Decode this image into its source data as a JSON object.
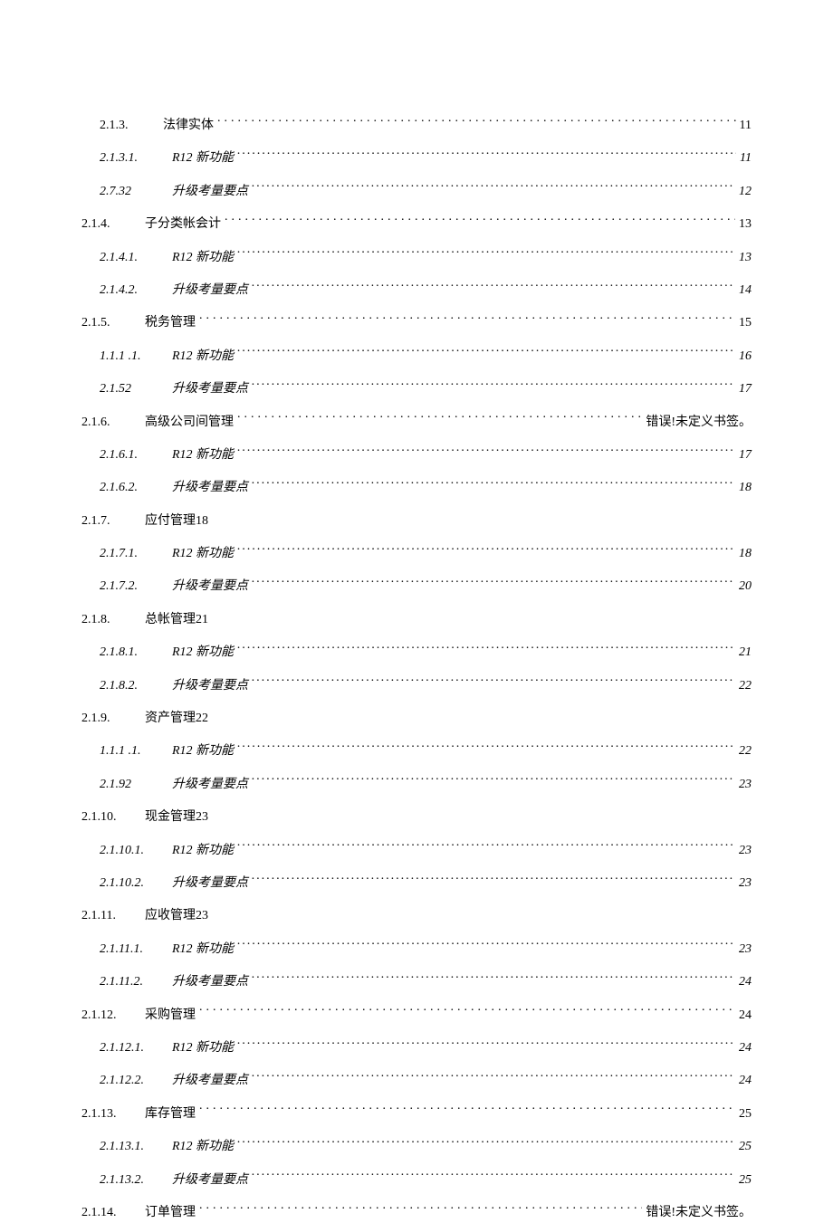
{
  "toc": [
    {
      "level": 0,
      "num": "2.1.3.",
      "title": "法律实体",
      "page": "11",
      "leader": true,
      "indent": 20
    },
    {
      "level": 1,
      "num": "2.1.3.1.",
      "title": "R12 新功能",
      "page": "11",
      "leader": true
    },
    {
      "level": 1,
      "num": "2.7.32",
      "title": "升级考量要点",
      "page": "12",
      "leader": true
    },
    {
      "level": 0,
      "num": "2.1.4.",
      "title": "子分类帐会计",
      "page": "13",
      "leader": true
    },
    {
      "level": 1,
      "num": "2.1.4.1.",
      "title": "R12 新功能",
      "page": "13",
      "leader": true
    },
    {
      "level": 1,
      "num": "2.1.4.2.",
      "title": "升级考量要点",
      "page": "14",
      "leader": true
    },
    {
      "level": 0,
      "num": "2.1.5.",
      "title": "税务管理",
      "page": "15",
      "leader": true
    },
    {
      "level": 1,
      "num": "1.1.1  .1.",
      "title": "R12 新功能",
      "page": "16",
      "leader": true
    },
    {
      "level": 1,
      "num": "2.1.52",
      "title": "升级考量要点",
      "page": "17",
      "leader": true
    },
    {
      "level": 0,
      "num": "2.1.6.",
      "title": "高级公司间管理",
      "page": "错误!未定义书签。",
      "leader": true
    },
    {
      "level": 1,
      "num": "2.1.6.1.",
      "title": "R12 新功能",
      "page": "17",
      "leader": true
    },
    {
      "level": 1,
      "num": "2.1.6.2.",
      "title": "升级考量要点",
      "page": "18",
      "leader": true
    },
    {
      "level": 0,
      "num": "2.1.7.",
      "title": "应付管理18",
      "page": "",
      "leader": false
    },
    {
      "level": 1,
      "num": "2.1.7.1.",
      "title": "R12 新功能",
      "page": "18",
      "leader": true
    },
    {
      "level": 1,
      "num": "2.1.7.2.",
      "title": "升级考量要点",
      "page": "20",
      "leader": true
    },
    {
      "level": 0,
      "num": "2.1.8.",
      "title": "总帐管理21",
      "page": "",
      "leader": false
    },
    {
      "level": 1,
      "num": "2.1.8.1.",
      "title": "R12 新功能",
      "page": "21",
      "leader": true
    },
    {
      "level": 1,
      "num": "2.1.8.2.",
      "title": "升级考量要点",
      "page": "22",
      "leader": true
    },
    {
      "level": 0,
      "num": "2.1.9.",
      "title": "资产管理22",
      "page": "",
      "leader": false
    },
    {
      "level": 1,
      "num": "1.1.1  .1.",
      "title": "R12 新功能",
      "page": "22",
      "leader": true
    },
    {
      "level": 1,
      "num": "2.1.92",
      "title": "升级考量要点",
      "page": "23",
      "leader": true
    },
    {
      "level": 0,
      "num": "2.1.10.",
      "title": "现金管理23",
      "page": "",
      "leader": false
    },
    {
      "level": 1,
      "num": "2.1.10.1.",
      "title": "R12 新功能",
      "page": "23",
      "leader": true
    },
    {
      "level": 1,
      "num": "2.1.10.2.",
      "title": "升级考量要点",
      "page": "23",
      "leader": true
    },
    {
      "level": 0,
      "num": "2.1.11.",
      "title": "应收管理23",
      "page": "",
      "leader": false
    },
    {
      "level": 1,
      "num": "2.1.11.1.",
      "title": "R12 新功能",
      "page": "23",
      "leader": true
    },
    {
      "level": 1,
      "num": "2.1.11.2.",
      "title": "升级考量要点",
      "page": "24",
      "leader": true
    },
    {
      "level": 0,
      "num": "2.1.12.",
      "title": "采购管理",
      "page": "24",
      "leader": true
    },
    {
      "level": 1,
      "num": "2.1.12.1.",
      "title": "R12 新功能",
      "page": "24",
      "leader": true
    },
    {
      "level": 1,
      "num": "2.1.12.2.",
      "title": "升级考量要点",
      "page": "24",
      "leader": true
    },
    {
      "level": 0,
      "num": "2.1.13.",
      "title": "库存管理",
      "page": "25",
      "leader": true
    },
    {
      "level": 1,
      "num": "2.1.13.1.",
      "title": "R12 新功能",
      "page": "25",
      "leader": true
    },
    {
      "level": 1,
      "num": "2.1.13.2.",
      "title": "升级考量要点",
      "page": "25",
      "leader": true
    },
    {
      "level": 0,
      "num": "2.1.14.",
      "title": "订单管理",
      "page": "错误!未定义书签。",
      "leader": true
    }
  ]
}
